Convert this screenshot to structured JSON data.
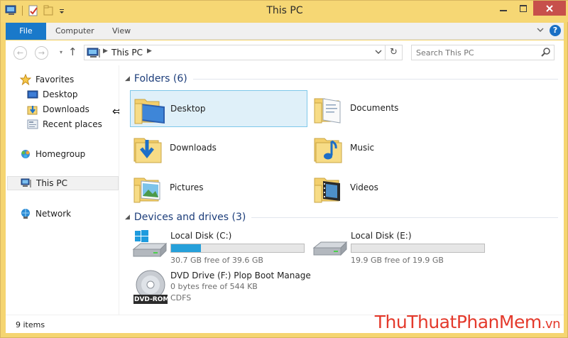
{
  "window": {
    "title": "This PC"
  },
  "ribbon": {
    "tabs": [
      "File",
      "Computer",
      "View"
    ]
  },
  "nav": {
    "breadcrumb": [
      "This PC"
    ],
    "search_placeholder": "Search This PC"
  },
  "sidebar": {
    "items": [
      {
        "label": "Favorites",
        "icon": "star-icon"
      },
      {
        "label": "Desktop",
        "icon": "desktop-icon"
      },
      {
        "label": "Downloads",
        "icon": "downloads-icon"
      },
      {
        "label": "Recent places",
        "icon": "recent-places-icon"
      },
      {
        "label": "Homegroup",
        "icon": "homegroup-icon"
      },
      {
        "label": "This PC",
        "icon": "computer-icon",
        "selected": true
      },
      {
        "label": "Network",
        "icon": "network-icon"
      }
    ]
  },
  "folders": {
    "header": "Folders (6)",
    "items": [
      {
        "name": "Desktop",
        "icon": "desktop-folder-icon",
        "selected": true
      },
      {
        "name": "Documents",
        "icon": "documents-folder-icon"
      },
      {
        "name": "Downloads",
        "icon": "downloads-folder-icon"
      },
      {
        "name": "Music",
        "icon": "music-folder-icon"
      },
      {
        "name": "Pictures",
        "icon": "pictures-folder-icon"
      },
      {
        "name": "Videos",
        "icon": "videos-folder-icon"
      }
    ]
  },
  "drives": {
    "header": "Devices and drives (3)",
    "items": [
      {
        "name": "Local Disk (C:)",
        "free": "30.7 GB free of 39.6 GB",
        "used_fraction": 0.225,
        "icon": "windows-drive-icon"
      },
      {
        "name": "Local Disk (E:)",
        "free": "19.9 GB free of 19.9 GB",
        "used_fraction": 0.0,
        "icon": "hard-drive-icon"
      },
      {
        "name": "DVD Drive (F:) Plop Boot Manage",
        "free": "0 bytes free of 544 KB",
        "fs": "CDFS",
        "icon": "dvd-drive-icon",
        "disc_label": "DVD-ROM"
      }
    ]
  },
  "status": {
    "count": "9 items"
  },
  "watermark": {
    "part1": "ThuThuat",
    "part2": "PhanMem",
    "part3": ".vn"
  },
  "colors": {
    "accent": "#1979ca",
    "title_bar": "#f6d774",
    "drive_bar": "#26a0da",
    "close": "#c7504b"
  }
}
